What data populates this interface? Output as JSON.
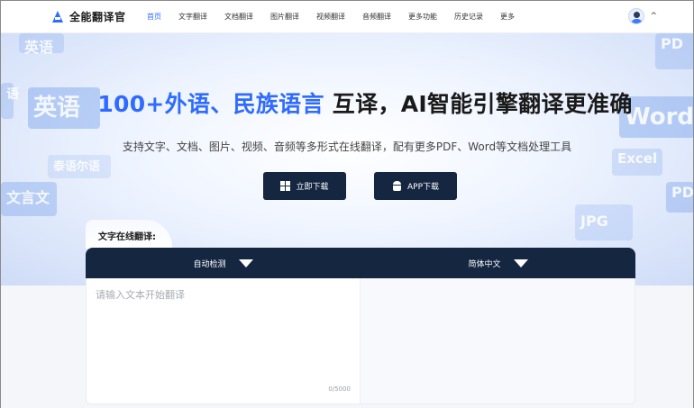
{
  "header": {
    "logo_text": "全能翻译官",
    "nav": [
      {
        "label": "首页",
        "active": true
      },
      {
        "label": "文字翻译",
        "active": false
      },
      {
        "label": "文档翻译",
        "active": false
      },
      {
        "label": "图片翻译",
        "active": false
      },
      {
        "label": "视频翻译",
        "active": false
      },
      {
        "label": "音频翻译",
        "active": false
      },
      {
        "label": "更多功能",
        "active": false
      },
      {
        "label": "历史记录",
        "active": false
      },
      {
        "label": "更多",
        "active": false
      }
    ],
    "user_caret": "^"
  },
  "hero": {
    "title_highlight": "100+外语、民族语言",
    "title_rest": "互译，AI智能引擎翻译更准确",
    "subtitle": "支持文字、文档、图片、视频、音频等多形式在线翻译，配有更多PDF、Word等文档处理工具",
    "download_button": "立即下载",
    "app_button": "APP下载",
    "decorations": {
      "l1": "英语",
      "l2": "英语",
      "l3": "泰语尔语",
      "l4": "文言文",
      "l5": "语",
      "r1": "PD",
      "r2": "Word",
      "r3": "Excel",
      "r4": "PD",
      "r5": "JPG"
    }
  },
  "translator": {
    "tab_label": "文字在线翻译:",
    "source_lang": "自动检测",
    "target_lang": "简体中文",
    "input_placeholder": "请输入文本开始翻译",
    "input_value": "",
    "char_count": "0/5000"
  },
  "colors": {
    "accent": "#2f6bff",
    "dark_navy": "#152641"
  }
}
